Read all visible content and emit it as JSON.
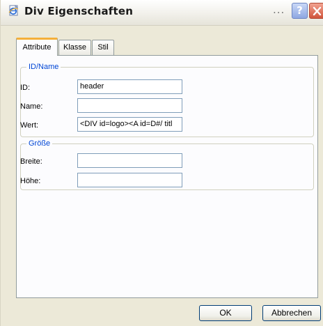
{
  "window": {
    "title": "Div Eigenschaften",
    "ellipsis": "...",
    "help_label": "?"
  },
  "tabs": [
    {
      "label": "Attribute",
      "active": true
    },
    {
      "label": "Klasse",
      "active": false
    },
    {
      "label": "Stil",
      "active": false
    }
  ],
  "id_group": {
    "legend": "ID/Name",
    "fields": [
      {
        "label": "ID:",
        "value": "header"
      },
      {
        "label": "Name:",
        "value": ""
      },
      {
        "label": "Wert:",
        "value": "<DIV id=logo><A id=D#/ titl"
      }
    ]
  },
  "size_group": {
    "legend": "Größe",
    "fields": [
      {
        "label": "Breite:",
        "value": ""
      },
      {
        "label": "Höhe:",
        "value": ""
      }
    ]
  },
  "buttons": {
    "ok": "OK",
    "cancel": "Abbrechen"
  },
  "colors": {
    "accent_tab": "#f5b03a",
    "legend_blue": "#0046d5",
    "close_red": "#d0553c"
  },
  "icons": {
    "app": "ie-document-icon",
    "help": "help-icon",
    "close": "close-icon"
  }
}
